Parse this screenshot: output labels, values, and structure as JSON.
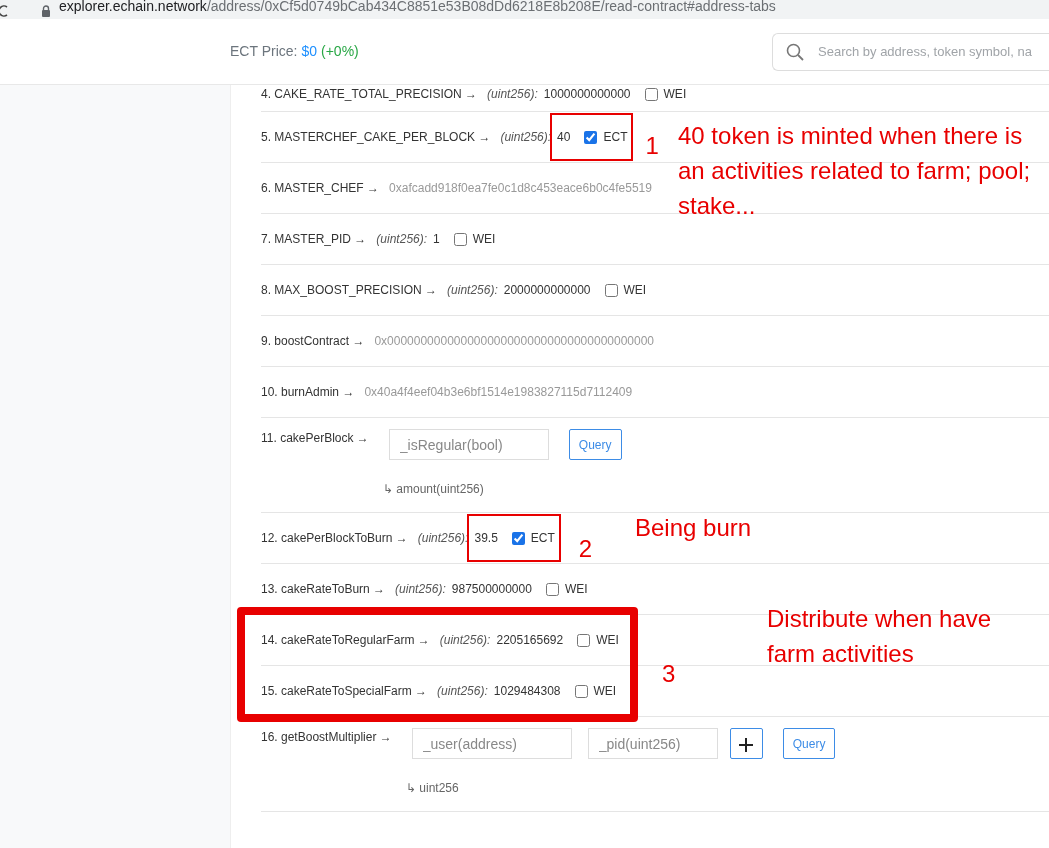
{
  "browser": {
    "url_host": "explorer.echain.network",
    "url_path": "/address/0xCf5d0749bCab434C8851e53B08dDd6218E8b208E/read-contract#address-tabs"
  },
  "header": {
    "price_label": "ECT Price:",
    "price_value": "$0",
    "price_change": "(+0%)",
    "search": {
      "placeholder": "Search by address, token symbol, na"
    }
  },
  "rows": [
    {
      "kind": "value",
      "label": "4. CAKE_RATE_TOTAL_PRECISION →",
      "type": "(uint256):",
      "value": "1000000000000",
      "unit": "WEI",
      "checked": false
    },
    {
      "kind": "value",
      "label": "5. MASTERCHEF_CAKE_PER_BLOCK →",
      "type": "(uint256):",
      "value": "40",
      "unit": "ECT",
      "checked": true
    },
    {
      "kind": "address",
      "label": "6. MASTER_CHEF →",
      "value": "0xafcadd918f0ea7fe0c1d8c453eace6b0c4fe5519"
    },
    {
      "kind": "value",
      "label": "7. MASTER_PID →",
      "type": "(uint256):",
      "value": "1",
      "unit": "WEI",
      "checked": false
    },
    {
      "kind": "value",
      "label": "8. MAX_BOOST_PRECISION →",
      "type": "(uint256):",
      "value": "2000000000000",
      "unit": "WEI",
      "checked": false
    },
    {
      "kind": "address",
      "label": "9. boostContract →",
      "value": "0x0000000000000000000000000000000000000000"
    },
    {
      "kind": "address",
      "label": "10. burnAdmin →",
      "value": "0x40a4f4eef04b3e6bf1514e1983827115d7112409"
    },
    {
      "kind": "query",
      "label": "11. cakePerBlock →",
      "inputs": [
        {
          "placeholder": "_isRegular(bool)"
        }
      ],
      "add_button": false,
      "button": "Query",
      "output": "↳ amount(uint256)"
    },
    {
      "kind": "value",
      "label": "12. cakePerBlockToBurn →",
      "type": "(uint256):",
      "value": "39.5",
      "unit": "ECT",
      "checked": true
    },
    {
      "kind": "value",
      "label": "13. cakeRateToBurn →",
      "type": "(uint256):",
      "value": "987500000000",
      "unit": "WEI",
      "checked": false
    },
    {
      "kind": "value",
      "label": "14. cakeRateToRegularFarm →",
      "type": "(uint256):",
      "value": "2205165692",
      "unit": "WEI",
      "checked": false
    },
    {
      "kind": "value",
      "label": "15. cakeRateToSpecialFarm →",
      "type": "(uint256):",
      "value": "1029484308",
      "unit": "WEI",
      "checked": false
    },
    {
      "kind": "query",
      "label": "16. getBoostMultiplier →",
      "inputs": [
        {
          "placeholder": "_user(address)"
        },
        {
          "placeholder": "_pid(uint256)"
        }
      ],
      "add_button": true,
      "button": "Query",
      "output": "↳ uint256"
    }
  ],
  "annotations": [
    {
      "kind": "box"
    },
    {
      "kind": "number",
      "text": "1"
    },
    {
      "kind": "note",
      "text": "40 token is minted when there is an activities related to  farm; pool; stake..."
    },
    {
      "kind": "box"
    },
    {
      "kind": "number",
      "text": "2"
    },
    {
      "kind": "note",
      "text": "Being burn"
    },
    {
      "kind": "box"
    },
    {
      "kind": "number",
      "text": "3"
    },
    {
      "kind": "note",
      "text": "Distribute when have farm activities"
    }
  ]
}
